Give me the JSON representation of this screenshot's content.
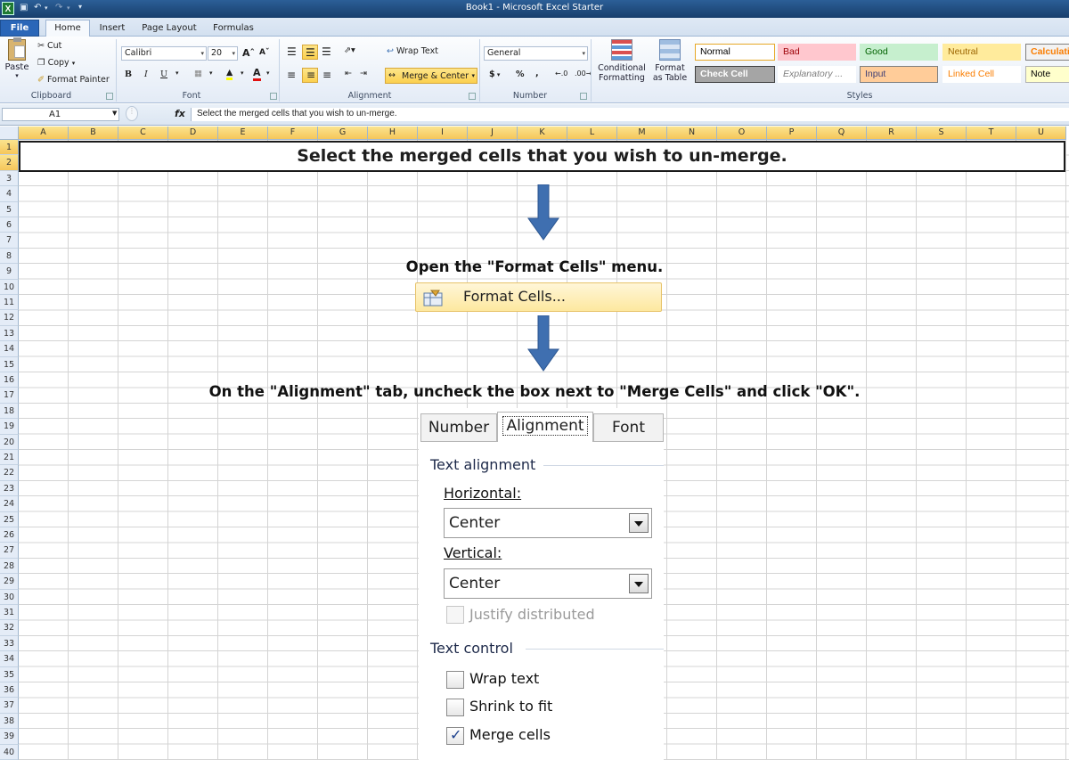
{
  "window": {
    "title": "Book1  -  Microsoft Excel Starter",
    "app_icon": "X"
  },
  "tabs": [
    "File",
    "Home",
    "Insert",
    "Page Layout",
    "Formulas"
  ],
  "ribbon": {
    "clipboard": {
      "paste": "Paste",
      "cut": "Cut",
      "copy": "Copy",
      "format_painter": "Format Painter",
      "label": "Clipboard"
    },
    "font": {
      "name": "Calibri",
      "size": "20",
      "bold": "B",
      "italic": "I",
      "underline": "U",
      "label": "Font"
    },
    "alignment": {
      "wrap_text": "Wrap Text",
      "merge_center": "Merge & Center",
      "label": "Alignment"
    },
    "number": {
      "format": "General",
      "currency": "$",
      "percent": "%",
      "comma": ",",
      "label": "Number"
    },
    "styles_group": {
      "conditional_1": "Conditional",
      "conditional_2": "Formatting",
      "format_1": "Format",
      "format_2": "as Table",
      "label": "Styles"
    },
    "styles": [
      {
        "name": "Normal",
        "color": "#000000",
        "bg": "#ffffff",
        "border": "#e6a827"
      },
      {
        "name": "Bad",
        "color": "#9c0006",
        "bg": "#ffc7ce",
        "border": "#ffc7ce"
      },
      {
        "name": "Good",
        "color": "#006100",
        "bg": "#c6efce",
        "border": "#c6efce"
      },
      {
        "name": "Neutral",
        "color": "#9c6500",
        "bg": "#ffeb9c",
        "border": "#ffeb9c"
      },
      {
        "name": "Calculati",
        "color": "#fa7d00",
        "bg": "#f2f2f2",
        "border": "#7f7f7f"
      },
      {
        "name": "Check Cell",
        "color": "#ffffff",
        "bg": "#a5a5a5",
        "border": "#3f3f3f"
      },
      {
        "name": "Explanatory ...",
        "color": "#7f7f7f",
        "bg": "#ffffff",
        "border": "#ffffff"
      },
      {
        "name": "Input",
        "color": "#3f3f76",
        "bg": "#ffcc99",
        "border": "#7f7f7f"
      },
      {
        "name": "Linked Cell",
        "color": "#fa7d00",
        "bg": "#ffffff",
        "border": "#ffffff"
      },
      {
        "name": "Note",
        "color": "#000000",
        "bg": "#ffffcc",
        "border": "#b2b2b2"
      }
    ]
  },
  "formula_bar": {
    "name_box": "A1",
    "fx": "fx",
    "content": "Select the merged cells that you wish to un-merge."
  },
  "sheet": {
    "columns": [
      "A",
      "B",
      "C",
      "D",
      "E",
      "F",
      "G",
      "H",
      "I",
      "J",
      "K",
      "L",
      "M",
      "N",
      "O",
      "P",
      "Q",
      "R",
      "S",
      "T",
      "U"
    ],
    "rows": [
      "1",
      "2",
      "3",
      "4",
      "5",
      "6",
      "7",
      "8",
      "9",
      "10",
      "11",
      "12",
      "13",
      "14",
      "15",
      "16",
      "17",
      "18",
      "19",
      "20",
      "21",
      "22",
      "23",
      "24",
      "25",
      "26",
      "27",
      "28",
      "29",
      "30",
      "31",
      "32",
      "33",
      "34",
      "35",
      "36",
      "37",
      "38",
      "39",
      "40"
    ],
    "merged_text": "Select the merged cells that you wish to un-merge."
  },
  "steps": {
    "step2": "Open the \"Format Cells\" menu.",
    "menu_item": "Format Cells...",
    "step3": "On the \"Alignment\" tab, uncheck the box next to \"Merge Cells\" and click \"OK\"."
  },
  "dialog": {
    "tabs": [
      "Number",
      "Alignment",
      "Font"
    ],
    "text_alignment": "Text alignment",
    "horizontal_label": "Horizontal:",
    "horizontal_value": "Center",
    "vertical_label": "Vertical:",
    "vertical_value": "Center",
    "justify_distributed": "Justify distributed",
    "text_control": "Text control",
    "wrap_text": "Wrap text",
    "shrink_to_fit": "Shrink to fit",
    "merge_cells": "Merge cells",
    "merge_cells_checked": true
  },
  "colors": {
    "arrow": "#3f6fb0",
    "ribbon_accent": "#2a66b8"
  }
}
